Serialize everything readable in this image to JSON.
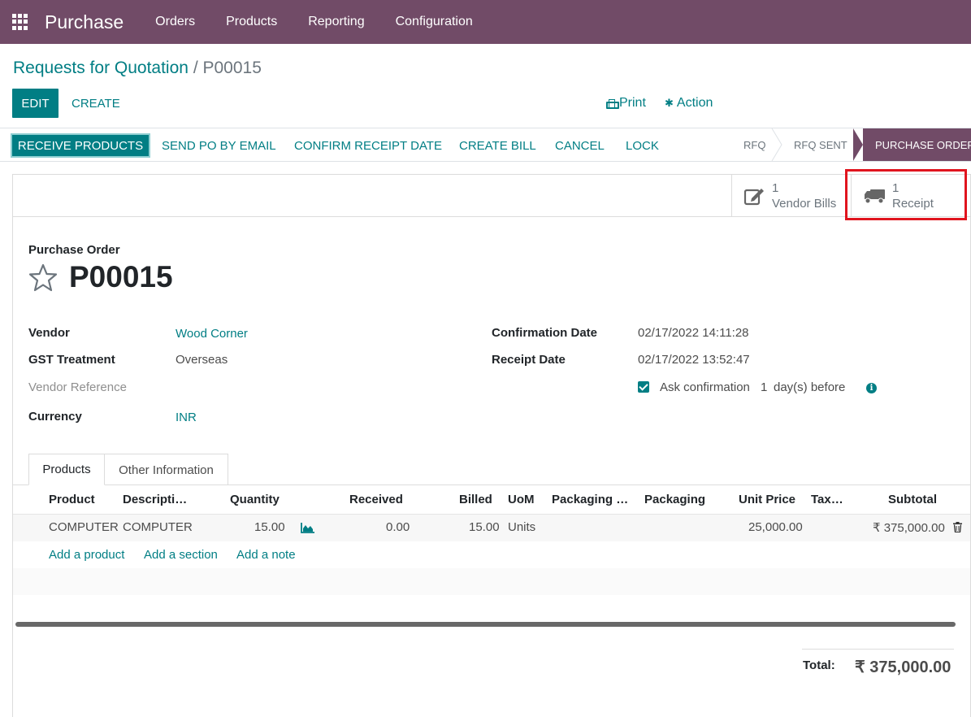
{
  "navbar": {
    "app_name": "Purchase",
    "menu": [
      "Orders",
      "Products",
      "Reporting",
      "Configuration"
    ]
  },
  "breadcrumb": {
    "parent": "Requests for Quotation",
    "separator": "/",
    "current": "P00015"
  },
  "controls": {
    "edit_label": "EDIT",
    "create_label": "CREATE",
    "print_label": "Print",
    "action_label": "Action"
  },
  "statusbar": {
    "buttons": [
      "RECEIVE PRODUCTS",
      "SEND PO BY EMAIL",
      "CONFIRM RECEIPT DATE",
      "CREATE BILL",
      "CANCEL",
      "LOCK"
    ],
    "stages": [
      "RFQ",
      "RFQ SENT",
      "PURCHASE ORDER"
    ],
    "active_stage": "PURCHASE ORDER"
  },
  "smart_buttons": {
    "vendor_bills": {
      "count": "1",
      "label": "Vendor Bills"
    },
    "receipt": {
      "count": "1",
      "label": "Receipt"
    }
  },
  "form": {
    "doc_type": "Purchase Order",
    "name": "P00015",
    "vendor_label": "Vendor",
    "vendor_value": "Wood Corner",
    "gst_label": "GST Treatment",
    "gst_value": "Overseas",
    "vendor_ref_label": "Vendor Reference",
    "currency_label": "Currency",
    "currency_value": "INR",
    "confirmation_label": "Confirmation Date",
    "confirmation_value": "02/17/2022 14:11:28",
    "receipt_label": "Receipt Date",
    "receipt_value": "02/17/2022 13:52:47",
    "ask_confirmation_label": "Ask confirmation",
    "ask_confirmation_days": "1",
    "ask_confirmation_suffix": "day(s) before",
    "ask_confirmation_checked": true
  },
  "tabs": [
    "Products",
    "Other Information"
  ],
  "table": {
    "headers": [
      "Product",
      "Descripti…",
      "Quantity",
      "Received",
      "Billed",
      "UoM",
      "Packaging …",
      "Packaging",
      "Unit Price",
      "Tax…",
      "Subtotal"
    ],
    "rows": [
      {
        "product": "COMPUTER",
        "description": "COMPUTER",
        "quantity": "15.00",
        "received": "0.00",
        "billed": "15.00",
        "uom": "Units",
        "packaging_qty": "",
        "packaging": "",
        "unit_price": "25,000.00",
        "taxes": "",
        "subtotal": "₹ 375,000.00"
      }
    ],
    "add_links": [
      "Add a product",
      "Add a section",
      "Add a note"
    ]
  },
  "totals": {
    "label": "Total:",
    "value": "₹ 375,000.00"
  },
  "colors": {
    "brand": "#714B67",
    "accent": "#017e84",
    "highlight": "#e0141e"
  }
}
